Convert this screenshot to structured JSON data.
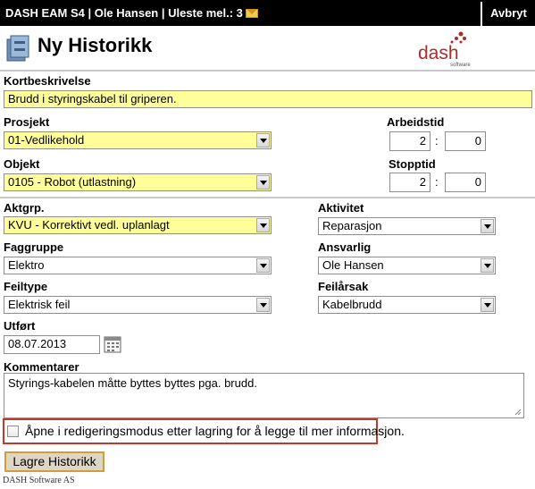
{
  "topbar": {
    "app_info": "DASH EAM S4 | Ole Hansen | Uleste mel.: 3",
    "mail_icon": "envelope-icon",
    "cancel_label": "Avbryt"
  },
  "header": {
    "title": "Ny Historikk",
    "logo_text": "dash",
    "logo_subtext": "software"
  },
  "form": {
    "kortbeskrivelse": {
      "label": "Kortbeskrivelse",
      "value": "Brudd i styringskabel til griperen."
    },
    "prosjekt": {
      "label": "Prosjekt",
      "value": "01-Vedlikehold"
    },
    "objekt": {
      "label": "Objekt",
      "value": "0105 - Robot (utlastning)"
    },
    "arbeidstid": {
      "label": "Arbeidstid",
      "hours": "2",
      "minutes": "0",
      "separator": ":"
    },
    "stopptid": {
      "label": "Stopptid",
      "hours": "2",
      "minutes": "0",
      "separator": ":"
    },
    "aktgrp": {
      "label": "Aktgrp.",
      "value": "KVU - Korrektivt vedl. uplanlagt"
    },
    "aktivitet": {
      "label": "Aktivitet",
      "value": "Reparasjon"
    },
    "faggruppe": {
      "label": "Faggruppe",
      "value": "Elektro"
    },
    "ansvarlig": {
      "label": "Ansvarlig",
      "value": "Ole Hansen"
    },
    "feiltype": {
      "label": "Feiltype",
      "value": "Elektrisk feil"
    },
    "feilarsak": {
      "label": "Feilårsak",
      "value": "Kabelbrudd"
    },
    "utfort": {
      "label": "Utført",
      "value": "08.07.2013"
    },
    "kommentarer": {
      "label": "Kommentarer",
      "value": "Styrings-kabelen måtte byttes byttes pga. brudd."
    },
    "edit_mode": {
      "label": "Åpne i redigeringsmodus etter lagring for å legge til mer informasjon.",
      "checked": false
    }
  },
  "actions": {
    "save_label": "Lagre Historikk"
  },
  "footer": {
    "text": "DASH Software AS"
  },
  "colors": {
    "highlight": "#ffff99",
    "topbar": "#000000",
    "accent_red": "#c0392b",
    "logo_red": "#b02a2a"
  }
}
